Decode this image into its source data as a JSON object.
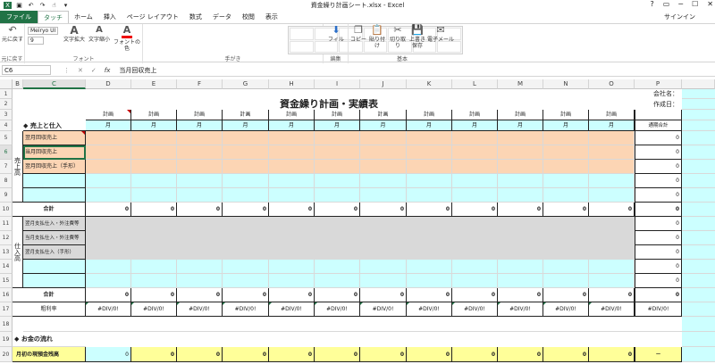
{
  "window": {
    "title": "資金繰り計画シート.xlsx - Excel",
    "signin": "サインイン",
    "controls": [
      "?",
      "▭",
      "─",
      "☐",
      "✕"
    ]
  },
  "tabs": [
    "ファイル",
    "タッチ",
    "ホーム",
    "挿入",
    "ページ レイアウト",
    "数式",
    "データ",
    "校閲",
    "表示"
  ],
  "ribbon": {
    "undo": "元に戻す",
    "font_name": "Meiryo UI",
    "font_size": "9",
    "grow": "文字拡大",
    "shrink": "文字縮小",
    "font_color": "フォントの色",
    "groups": {
      "undo": "元に戻す",
      "font": "フォント",
      "ink": "手がき",
      "edit": "編集",
      "basic": "基本"
    },
    "fill": "フィル",
    "copy": "コピー",
    "paste": "貼り付け",
    "cut": "切り取り",
    "save": "上書き\n保存",
    "email": "電子メール"
  },
  "formula": {
    "namebox": "C6",
    "fx": "fx",
    "value": "当月回収売上"
  },
  "columns": [
    "B",
    "C",
    "D",
    "E",
    "F",
    "G",
    "H",
    "I",
    "J",
    "K",
    "L",
    "M",
    "N",
    "O",
    "P"
  ],
  "rows": [
    "1",
    "2",
    "3",
    "4",
    "5",
    "6",
    "7",
    "8",
    "9",
    "10",
    "11",
    "12",
    "13",
    "14",
    "15",
    "16",
    "17",
    "18",
    "19",
    "20"
  ],
  "sheet": {
    "title": "資金繰り計画・実績表",
    "company": "会社名：",
    "created": "作成日：",
    "plan": "計画",
    "month": "月",
    "section1": "◆ 売上と仕入",
    "section2": "◆ お金の流れ",
    "sales_label": "売上高",
    "purchase_label": "仕入高",
    "sales_rows": [
      "翌月回収売上",
      "当月回収売上",
      "翌月回収売上（手形）"
    ],
    "purchase_rows": [
      "翌月支払仕入・外注費等",
      "当月支払仕入・外注費等",
      "翌月支払仕入（手形）"
    ],
    "total": "合計",
    "period_total": "通期合計",
    "margin": "粗利率",
    "divzero": "#DIV/0!",
    "zero": "0",
    "dash": "－",
    "opening": "月初の現預金残高"
  }
}
